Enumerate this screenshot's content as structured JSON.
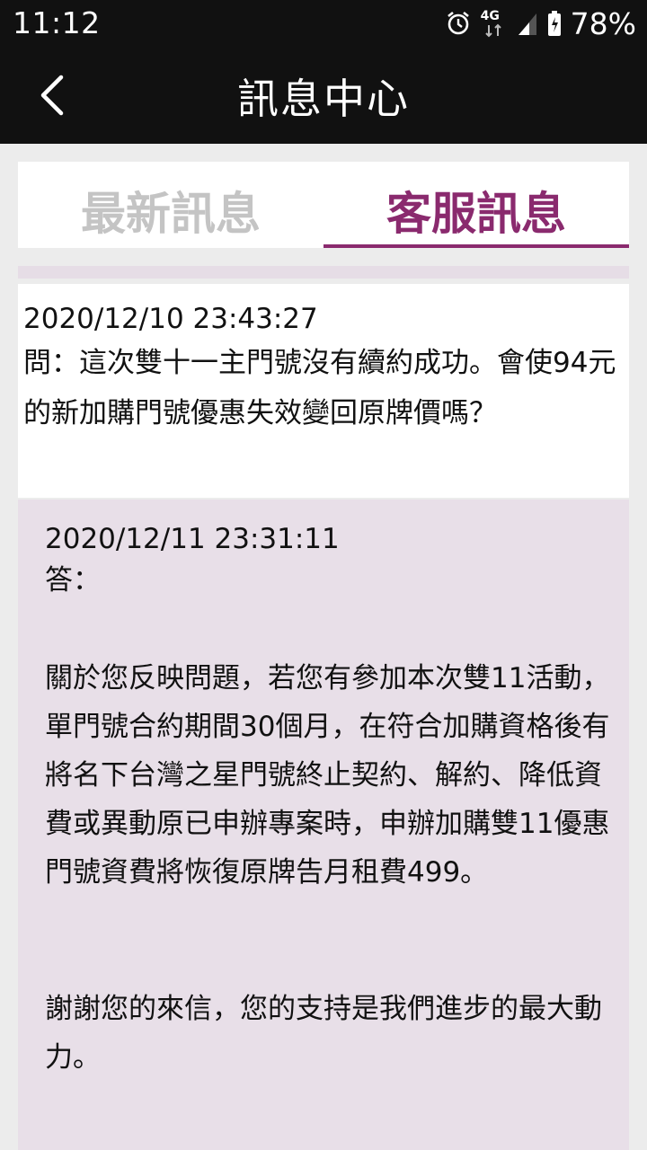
{
  "status_bar": {
    "time": "11:12",
    "network": "4G",
    "battery": "78%",
    "icons": [
      "alarm-icon",
      "network-4g-icon",
      "signal-icon",
      "battery-icon"
    ]
  },
  "app_bar": {
    "title": "訊息中心",
    "back_icon": "back-chevron-icon"
  },
  "tabs": [
    {
      "label": "最新訊息",
      "active": false
    },
    {
      "label": "客服訊息",
      "active": true
    }
  ],
  "colors": {
    "accent": "#8a2a6e",
    "answer_bg": "#e8dfe8",
    "bar_bg": "#111111"
  },
  "message": {
    "question": {
      "timestamp": "2020/12/10 23:43:27",
      "text": "問：這次雙十一主門號沒有續約成功。會使94元的新加購門號優惠失效變回原牌價嗎？"
    },
    "answer": {
      "timestamp": "2020/12/11 23:31:11",
      "label": "答：",
      "paragraph_1": "關於您反映問題，若您有參加本次雙11活動，單門號合約期間30個月，在符合加購資格後有將名下台灣之星門號終止契約、解約、降低資費或異動原已申辦專案時，申辦加購雙11優惠門號資費將恢復原牌告月租費499。",
      "paragraph_2": "謝謝您的來信，您的支持是我們進步的最大動力。"
    }
  }
}
